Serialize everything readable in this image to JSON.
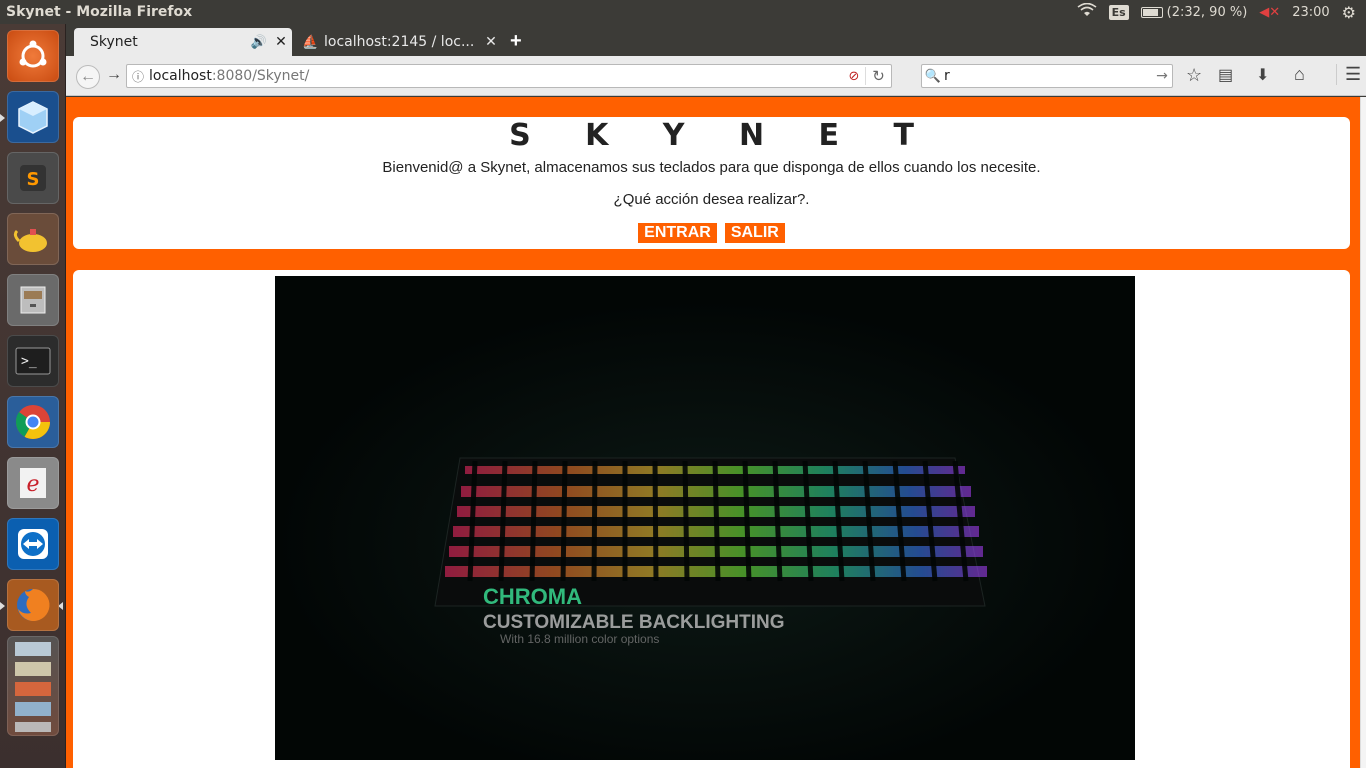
{
  "system": {
    "window_title": "Skynet - Mozilla Firefox",
    "keyboard_layout": "Es",
    "battery": "(2:32, 90 %)",
    "time": "23:00"
  },
  "launcher": {
    "items": [
      {
        "name": "ubuntu-dash-icon",
        "color": "#e05a1e",
        "glyph": "◎"
      },
      {
        "name": "virtualbox-icon",
        "color": "#1f6fc4",
        "glyph": "▣"
      },
      {
        "name": "sublime-text-icon",
        "color": "#4d4d4d",
        "glyph": "S"
      },
      {
        "name": "genie-lamp-icon",
        "color": "#f0c030",
        "glyph": "♨"
      },
      {
        "name": "file-cabinet-icon",
        "color": "#9a9a9a",
        "glyph": "▤"
      },
      {
        "name": "terminal-icon",
        "color": "#2c2c2c",
        "glyph": ">_"
      },
      {
        "name": "chrome-icon",
        "color": "#3a8ee6",
        "glyph": "◉"
      },
      {
        "name": "e-reader-icon",
        "color": "#e8e8e8",
        "glyph": "e"
      },
      {
        "name": "teamviewer-icon",
        "color": "#0e70c8",
        "glyph": "⇆"
      },
      {
        "name": "firefox-icon",
        "color": "#e66000",
        "glyph": "◐"
      }
    ]
  },
  "browser": {
    "tabs": [
      {
        "label": "Skynet"
      },
      {
        "label": "localhost:2145 / loc..."
      }
    ],
    "url_host": "localhost",
    "url_path": ":8080/Skynet/",
    "search_value": "r"
  },
  "page": {
    "title": "S K Y N E T",
    "welcome": "Bienvenid@ a Skynet, almacenamos sus teclados para que disponga de ellos cuando los necesite.",
    "question": "¿Qué acción desea realizar?.",
    "enter_label": "ENTRAR",
    "exit_label": "SALIR",
    "accent_color": "#ff6000",
    "video_overlay": {
      "line1": "CHROMA",
      "line2": "CUSTOMIZABLE BACKLIGHTING",
      "line3": "With 16.8 million color options"
    }
  }
}
